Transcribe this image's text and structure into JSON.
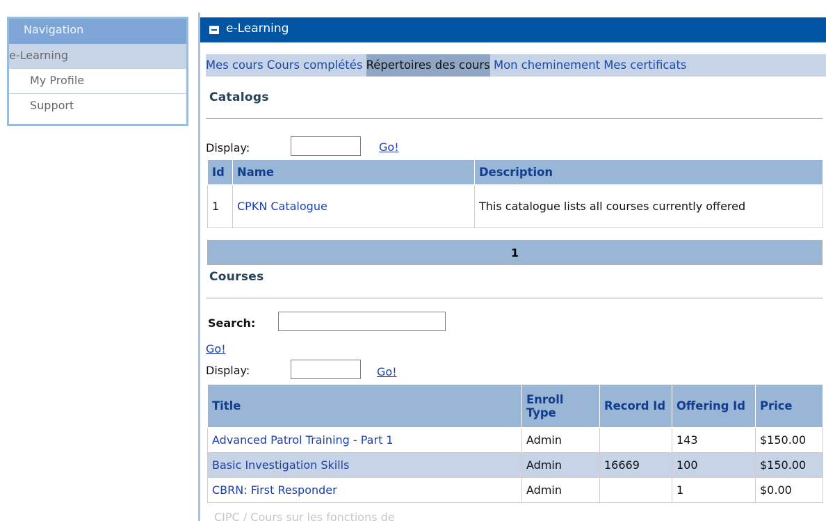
{
  "navigation": {
    "header": "Navigation",
    "items": [
      {
        "label": "e-Learning"
      },
      {
        "label": "My Profile"
      },
      {
        "label": "Support"
      }
    ]
  },
  "main": {
    "title": "e-Learning",
    "tabs": [
      {
        "label": "Mes cours"
      },
      {
        "label": "Cours complétés"
      },
      {
        "label": "Répertoires des cours"
      },
      {
        "label": "Mon cheminement"
      },
      {
        "label": "Mes certificats"
      }
    ]
  },
  "catalogs": {
    "heading": "Catalogs",
    "display_label": "Display:",
    "display_value": "",
    "go_label": "Go!",
    "columns": [
      "Id",
      "Name",
      "Description"
    ],
    "rows": [
      {
        "id": "1",
        "name": "CPKN Catalogue",
        "description": "This catalogue lists all courses currently offered"
      }
    ],
    "page": "1"
  },
  "courses": {
    "heading": "Courses",
    "search_label": "Search:",
    "search_value": "",
    "search_go": "Go!",
    "display_label": "Display:",
    "display_value": "",
    "display_go": "Go!",
    "columns": {
      "title": "Title",
      "enroll_type": "Enroll Type",
      "record_id": "Record Id",
      "offering_id": "Offering Id",
      "price": "Price"
    },
    "rows": [
      {
        "title": "Advanced Patrol Training - Part 1",
        "enroll_type": "Admin",
        "record_id": "",
        "offering_id": "143",
        "price": "$150.00"
      },
      {
        "title": "Basic Investigation Skills",
        "enroll_type": "Admin",
        "record_id": "16669",
        "offering_id": "100",
        "price": "$150.00"
      },
      {
        "title": "CBRN: First Responder",
        "enroll_type": "Admin",
        "record_id": "",
        "offering_id": "1",
        "price": "$0.00"
      }
    ],
    "cut_off_row": "CIPC / Cours sur les fonctions de"
  },
  "colors": {
    "header_blue": "#0255a3",
    "nav_header": "#7da6d6",
    "table_header": "#99b6d6",
    "row_alt": "#c7d3e6",
    "link": "#1a3fae"
  },
  "icons": {
    "collapse": "minus-square-icon"
  }
}
